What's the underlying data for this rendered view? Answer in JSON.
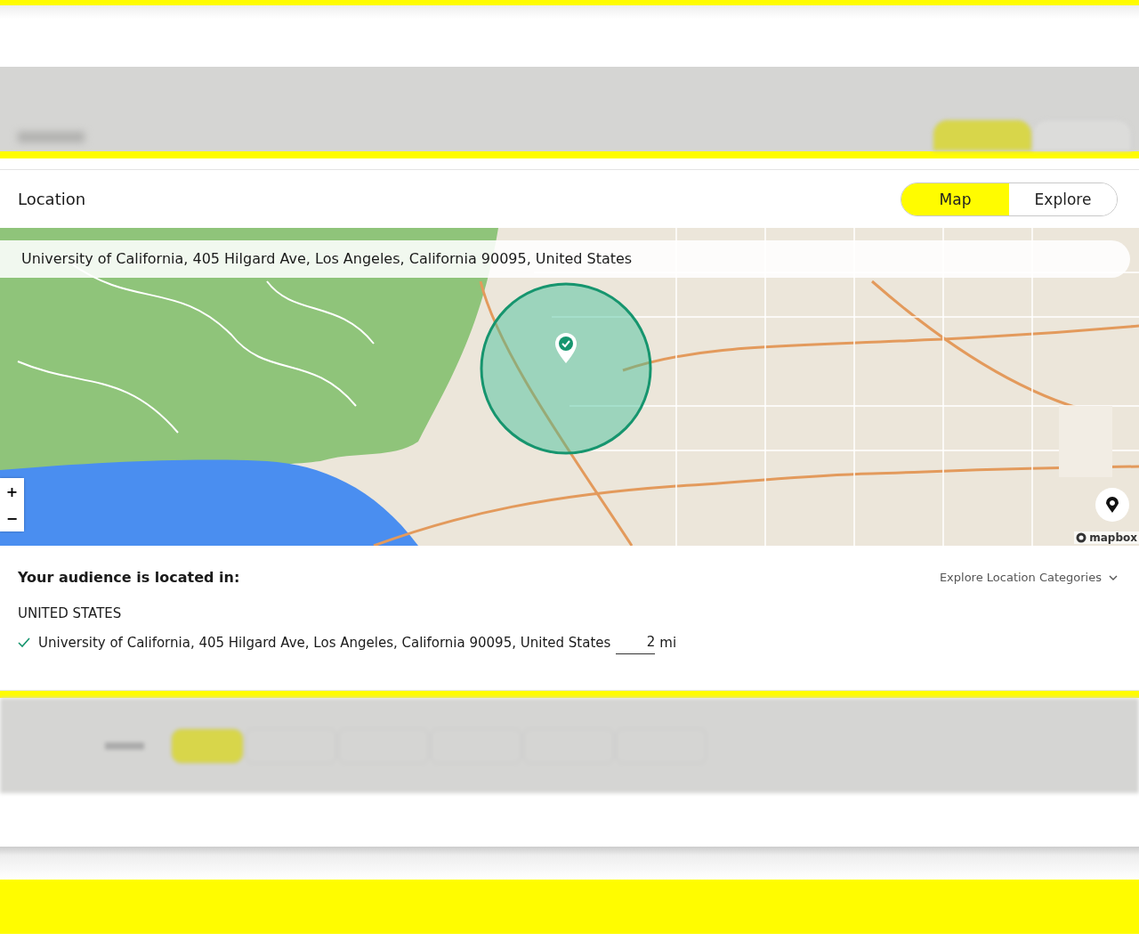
{
  "header": {
    "title": "Location",
    "view_toggle": [
      {
        "label": "Map",
        "selected": true
      },
      {
        "label": "Explore",
        "selected": false
      }
    ]
  },
  "map": {
    "search": {
      "value": "University of California, 405 Hilgard Ave, Los Angeles, California 90095, United States"
    },
    "zoom_in": "+",
    "zoom_out": "−",
    "attribution": "mapbox"
  },
  "audience": {
    "heading": "Your audience is located in:",
    "categories_link": "Explore Location Categories",
    "countries": [
      {
        "name": "UNITED STATES",
        "locations": [
          {
            "address": "University of California, 405 Hilgard Ave, Los Angeles, California 90095, United States",
            "checked": true,
            "radius": "2",
            "unit": "mi"
          }
        ]
      }
    ]
  }
}
